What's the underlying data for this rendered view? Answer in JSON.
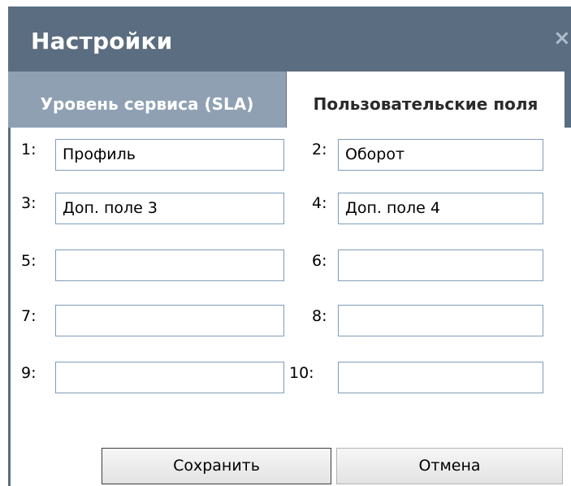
{
  "dialog": {
    "title": "Настройки",
    "close_symbol": "×"
  },
  "tabs": [
    {
      "label": "Уровень сервиса (SLA)",
      "active": false
    },
    {
      "label": "Пользовательские поля",
      "active": true
    }
  ],
  "fields": [
    {
      "number": "1:",
      "value": "Профиль"
    },
    {
      "number": "2:",
      "value": "Оборот"
    },
    {
      "number": "3:",
      "value": "Доп. поле 3"
    },
    {
      "number": "4:",
      "value": "Доп. поле 4"
    },
    {
      "number": "5:",
      "value": ""
    },
    {
      "number": "6:",
      "value": ""
    },
    {
      "number": "7:",
      "value": ""
    },
    {
      "number": "8:",
      "value": ""
    },
    {
      "number": "9:",
      "value": ""
    },
    {
      "number": "10:",
      "value": ""
    }
  ],
  "buttons": {
    "save_label": "Сохранить",
    "cancel_label": "Отмена"
  },
  "colors": {
    "header_bg": "#5b6d80",
    "inactive_tab_bg": "#8fa0b3",
    "field_border": "#7f9db9"
  }
}
